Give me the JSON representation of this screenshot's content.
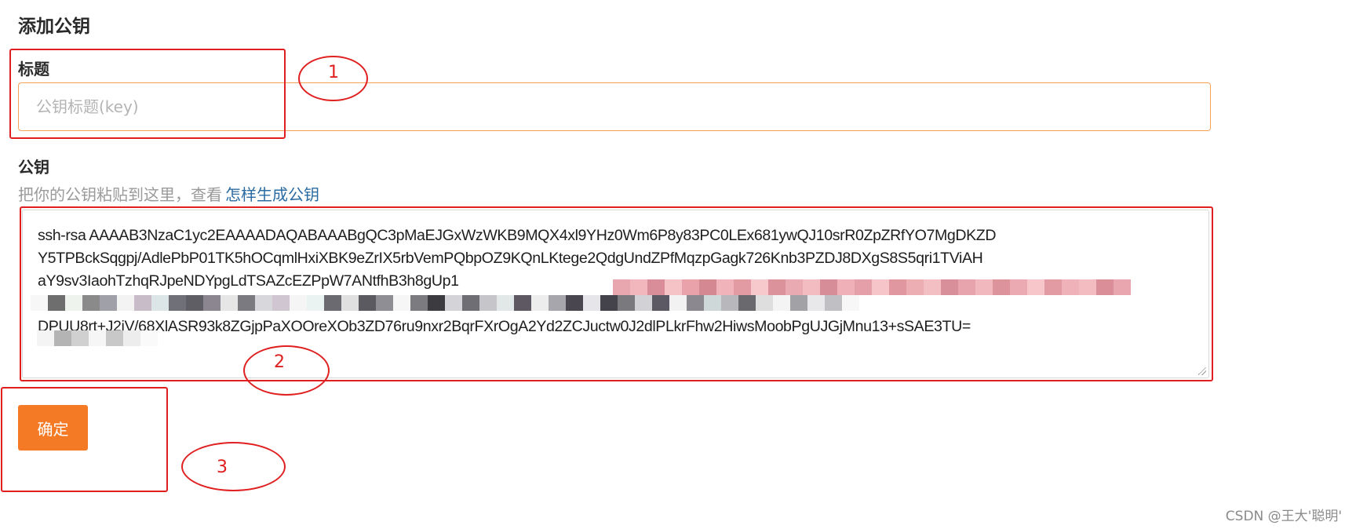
{
  "page": {
    "title": "添加公钥"
  },
  "form": {
    "title_label": "标题",
    "title_placeholder": "公钥标题(key)",
    "key_label": "公钥",
    "key_hint": "把你的公钥粘贴到这里，查看",
    "key_hint_link": "怎样生成公钥",
    "key_lines": [
      "ssh-rsa AAAAB3NzaC1yc2EAAAADAQABAAABgQC3pMaEJGxWzWKB9MQX4xl9YHz0Wm6P8y83PC0LEx681ywQJ10srR0ZpZRfYO7MgDKZD",
      "Y5TPBckSqgpj/AdlePbP01TK5hOCqmlHxiXBK9eZrIX5rbVemPQbpOZ9KQnLKtege2QdgUndZPfMqzpGagk726Knb3PZDJ8DXgS8S5qri1TViAH",
      "aY9sv3IaohTzhqRJpeNDYpgLdTSAZcEZPpW7ANtfhB3h8gUp1",
      "",
      "DPUU8rt+J2jV/68XlASR93k8ZGjpPaXOOreXOb3ZD76ru9nxr2BqrFXrOgA2Yd2ZCJuctw0J2dlPLkrFhw2HiwsMoobPgUJGjMnu13+sSAE3TU="
    ],
    "submit_label": "确定"
  },
  "annotations": {
    "marker_1": "1",
    "marker_2": "2",
    "marker_3": "3"
  },
  "watermark": "CSDN @王大'聪明'",
  "colors": {
    "accent": "#f57a26",
    "input_border": "#f5a25b",
    "link": "#2b6ca3",
    "annotation": "#e02020"
  }
}
